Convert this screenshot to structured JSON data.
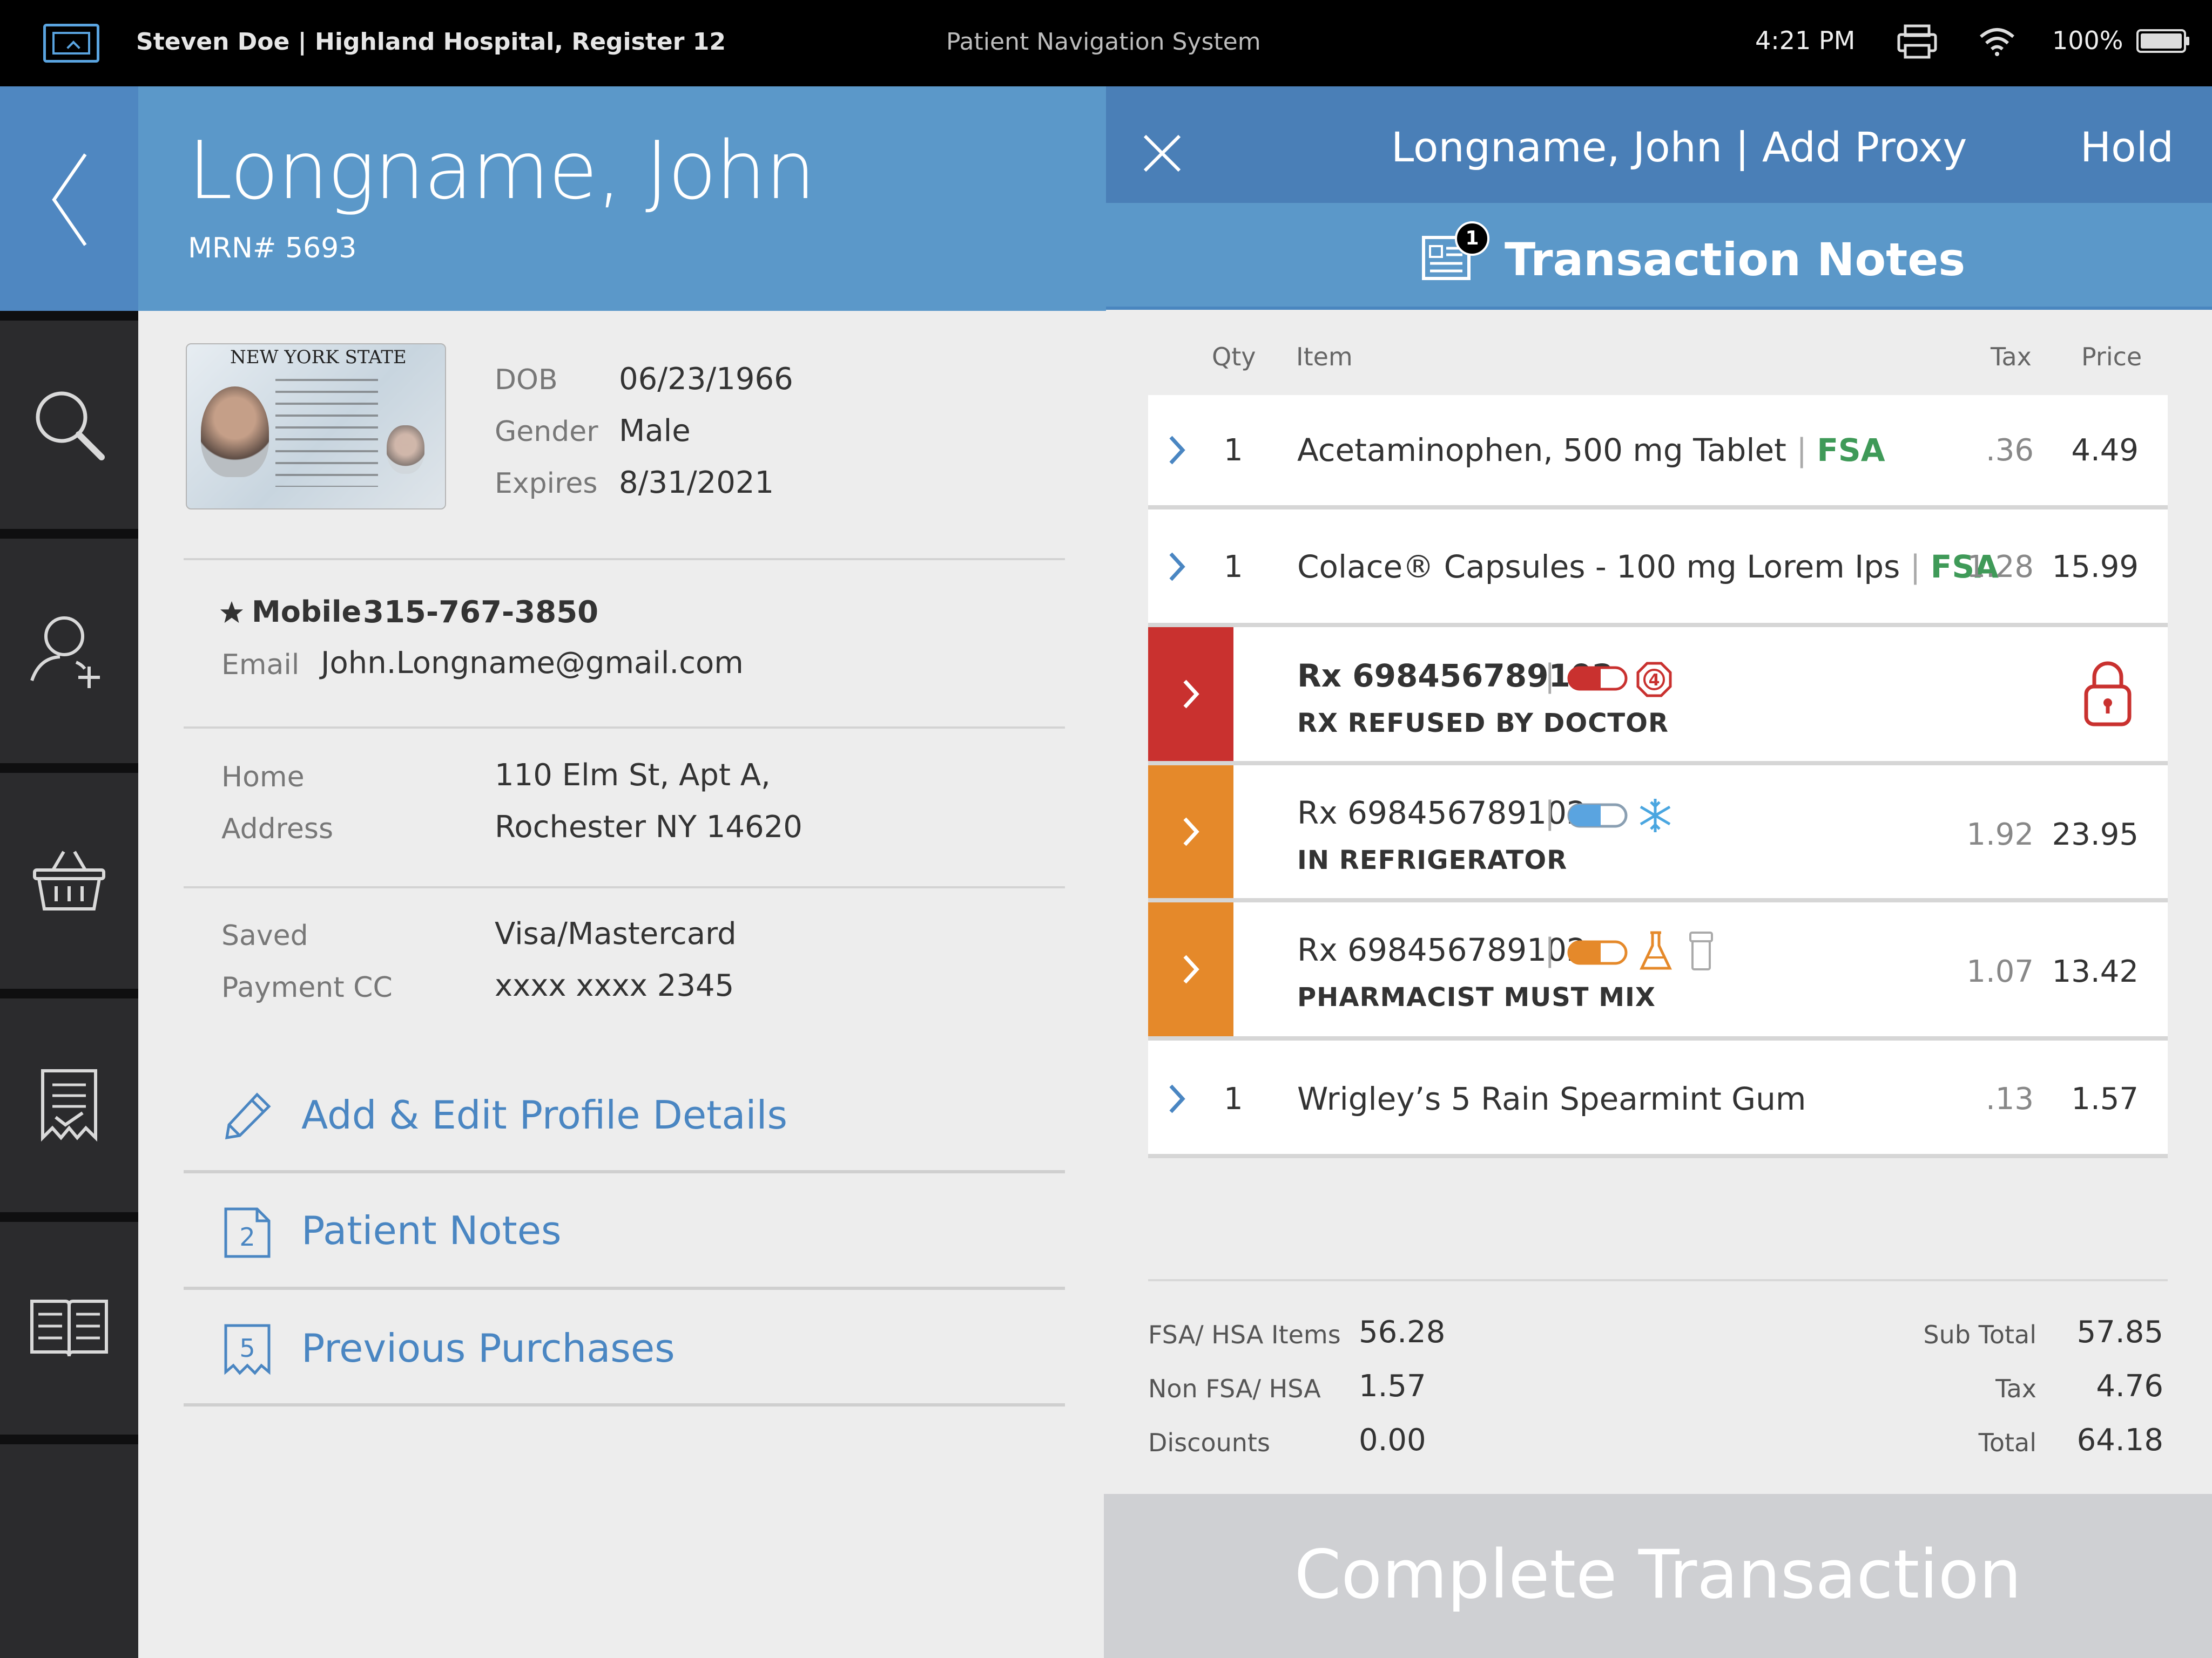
{
  "status_bar": {
    "user_info": "Steven Doe | Highland Hospital, Register 12",
    "system_name": "Patient Navigation System",
    "time": "4:21 PM",
    "battery": "100%"
  },
  "nav": {
    "items": [
      {
        "icon": "search-icon"
      },
      {
        "icon": "add-person-icon"
      },
      {
        "icon": "basket-icon"
      },
      {
        "icon": "receipt-icon"
      },
      {
        "icon": "book-icon"
      }
    ]
  },
  "patient": {
    "name": "Longname, John",
    "mrn": "MRN# 5693",
    "id_card_state": "NEW YORK STATE",
    "dob_label": "DOB",
    "dob": "06/23/1966",
    "gender_label": "Gender",
    "gender": "Male",
    "expires_label": "Expires",
    "expires": "8/31/2021",
    "mobile_label": "Mobile",
    "mobile": "315-767-3850",
    "email_label": "Email",
    "email": "John.Longname@gmail.com",
    "address_label_1": "Home",
    "address_label_2": "Address",
    "address_line_1": "110 Elm St, Apt A,",
    "address_line_2": "Rochester NY 14620",
    "payment_label_1": "Saved",
    "payment_label_2": "Payment CC",
    "payment_line_1": "Visa/Mastercard",
    "payment_line_2": "xxxx xxxx 2345"
  },
  "patient_links": {
    "edit_profile": "Add & Edit Profile Details",
    "patient_notes": "Patient Notes",
    "patient_notes_count": "2",
    "previous_purchases": "Previous Purchases",
    "previous_purchases_count": "5"
  },
  "transaction": {
    "title": "Longname, John | Add Proxy",
    "hold": "Hold",
    "notes_label": "Transaction Notes",
    "notes_count": "1",
    "columns": {
      "qty": "Qty",
      "item": "Item",
      "tax": "Tax",
      "price": "Price"
    },
    "items": [
      {
        "qty": "1",
        "name": "Acetaminophen, 500 mg Tablet",
        "fsa": "FSA",
        "tax": ".36",
        "price": "4.49"
      },
      {
        "qty": "1",
        "name": "Colace® Capsules - 100 mg Lorem Ips",
        "fsa": "FSA",
        "tax": "1.28",
        "price": "15.99"
      },
      {
        "rx": "Rx 698456789102",
        "status": "RX REFUSED BY DOCTOR",
        "color": "#c9312f",
        "badge": "4"
      },
      {
        "rx": "Rx 698456789102",
        "status": "IN REFRIGERATOR",
        "color": "#e5892a",
        "tax": "1.92",
        "price": "23.95"
      },
      {
        "rx": "Rx 698456789102",
        "status": "PHARMACIST MUST MIX",
        "color": "#e5892a",
        "tax": "1.07",
        "price": "13.42"
      },
      {
        "qty": "1",
        "name": "Wrigley’s 5 Rain Spearmint Gum",
        "tax": ".13",
        "price": "1.57"
      }
    ],
    "totals": {
      "fsa_label": "FSA/ HSA Items",
      "fsa_value": "56.28",
      "non_fsa_label": "Non FSA/ HSA",
      "non_fsa_value": "1.57",
      "discounts_label": "Discounts",
      "discounts_value": "0.00",
      "subtotal_label": "Sub Total",
      "subtotal_value": "57.85",
      "tax_label": "Tax",
      "tax_value": "4.76",
      "total_label": "Total",
      "total_value": "64.18"
    },
    "complete_button": "Complete Transaction"
  },
  "colors": {
    "primary_blue": "#5b98c9",
    "header_blue": "#4a7fb7",
    "link_blue": "#4a86c2",
    "fsa_green": "#3f9a58",
    "rx_red": "#c9312f",
    "rx_orange": "#e5892a"
  }
}
